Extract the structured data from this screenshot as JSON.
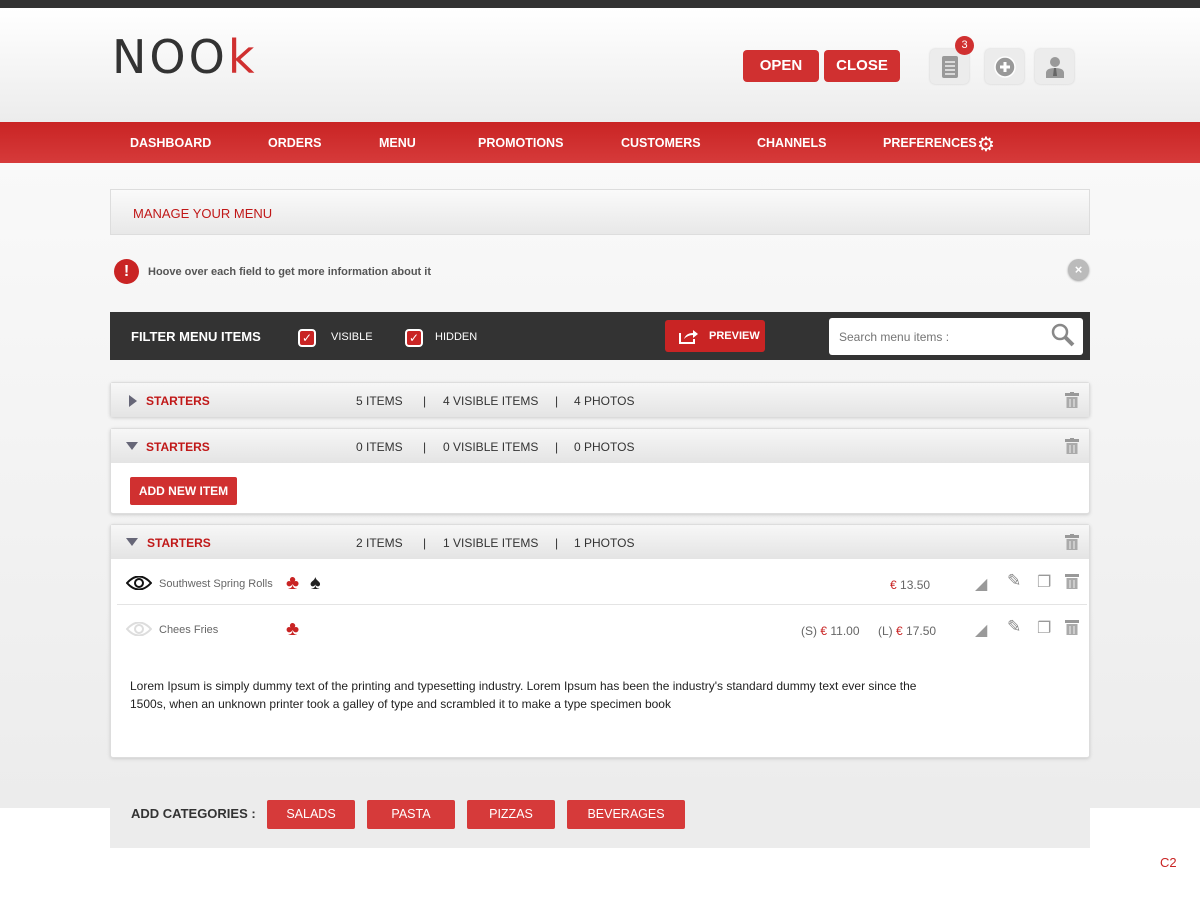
{
  "header": {
    "logo": "NOOk",
    "logo_main": "NOO",
    "logo_accent": "k",
    "open_label": "OPEN",
    "close_label": "CLOSE",
    "notification_count": "3"
  },
  "nav": [
    "DASHBOARD",
    "ORDERS",
    "MENU",
    "PROMOTIONS",
    "CUSTOMERS",
    "CHANNELS",
    "PREFERENCES"
  ],
  "page_title": "MANAGE YOUR MENU",
  "info_text": "Hoove over each field to get more information about it",
  "filter": {
    "title": "FILTER MENU ITEMS",
    "visible_label": "VISIBLE",
    "visible_checked": true,
    "hidden_label": "HIDDEN",
    "hidden_checked": true,
    "preview_label": "PREVIEW",
    "search_placeholder": "Search menu items :"
  },
  "categories": [
    {
      "name": "STARTERS",
      "items": "5 ITEMS",
      "visible": "4 VISIBLE ITEMS",
      "photos": "4 PHOTOS",
      "expanded": false
    },
    {
      "name": "STARTERS",
      "items": "0 ITEMS",
      "visible": "0 VISIBLE ITEMS",
      "photos": "0 PHOTOS",
      "expanded": true,
      "add_label": "ADD NEW ITEM"
    },
    {
      "name": "STARTERS",
      "items": "2 ITEMS",
      "visible": "1 VISIBLE ITEMS",
      "photos": "1 PHOTOS",
      "expanded": true,
      "rows": [
        {
          "name": "Southwest Spring Rolls",
          "visible": true,
          "price_currency": "€",
          "price": "13.50"
        },
        {
          "name": "Chees Fries",
          "visible": false,
          "small_label": "(S)",
          "small_currency": "€",
          "small_price": "11.00",
          "large_label": "(L)",
          "large_currency": "€",
          "large_price": "17.50"
        }
      ],
      "description": "Lorem Ipsum is simply dummy text of the printing and typesetting industry. Lorem Ipsum has been the industry's standard dummy text ever since the 1500s, when an unknown printer took a galley of type and scrambled it to make a type specimen book"
    }
  ],
  "separator": "|",
  "add_categories": {
    "label": "ADD CATEGORIES :",
    "buttons": [
      "SALADS",
      "PASTA",
      "PIZZAS",
      "BEVERAGES"
    ]
  },
  "corner_label": "C2",
  "colors": {
    "accent": "#d03030",
    "dark": "#333333"
  }
}
